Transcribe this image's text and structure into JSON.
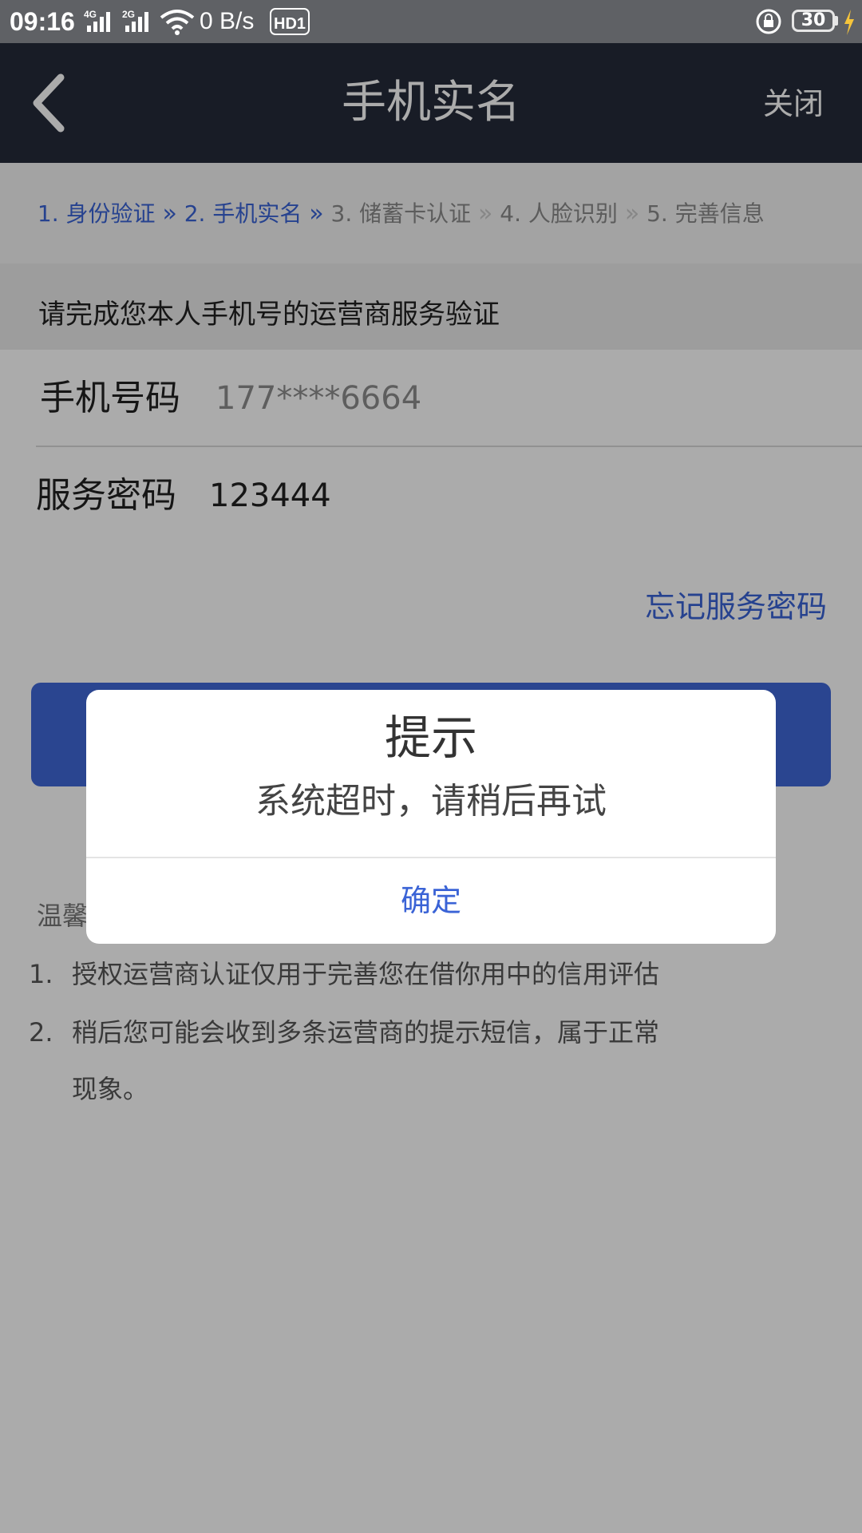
{
  "status_bar": {
    "time": "09:16",
    "network1": "4G",
    "network2": "2G",
    "speed": "0 B/s",
    "hd_badge": "HD1",
    "battery": "30"
  },
  "nav": {
    "title": "手机实名",
    "close_label": "关闭"
  },
  "steps": [
    {
      "label": "1. 身份验证",
      "done": true
    },
    {
      "label": "2. 手机实名",
      "done": true
    },
    {
      "label": "3. 储蓄卡认证",
      "done": false
    },
    {
      "label": "4. 人脸识别",
      "done": false
    },
    {
      "label": "5. 完善信息",
      "done": false
    }
  ],
  "form": {
    "hint": "请完成您本人手机号的运营商服务验证",
    "phone_label": "手机号码",
    "phone_value": "177****6664",
    "password_label": "服务密码",
    "password_value": "123444"
  },
  "forgot_password": "忘记服务密码",
  "tips": {
    "title": "温馨",
    "items": [
      {
        "num": "1.",
        "text": "授权运营商认证仅用于完善您在借你用中的信用评估"
      },
      {
        "num": "2.",
        "text": "稍后您可能会收到多条运营商的提示短信，属于正常"
      },
      {
        "num": "",
        "text": "现象。"
      }
    ]
  },
  "dialog": {
    "title": "提示",
    "message": "系统超时，请稍后再试",
    "confirm": "确定"
  },
  "colors": {
    "accent": "#3a63d6",
    "nav_bg": "#252a3a",
    "status_bg": "#5f6165"
  }
}
